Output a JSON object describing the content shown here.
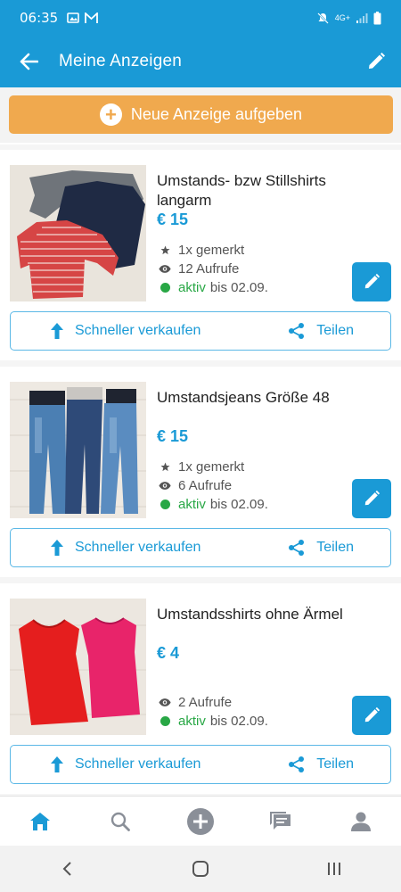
{
  "status_bar": {
    "time": "06:35",
    "network": "4G+"
  },
  "app_bar": {
    "title": "Meine Anzeigen"
  },
  "new_ad_button": {
    "label": "Neue Anzeige aufgeben"
  },
  "ads": [
    {
      "title": "Umstands- bzw Stillshirts langarm",
      "price": "€ 15",
      "saved": "1x gemerkt",
      "views": "12 Aufrufe",
      "status": "aktiv",
      "until": "bis 02.09.",
      "image": "long-sleeve-shirts"
    },
    {
      "title": "Umstandsjeans Größe 48",
      "price": "€ 15",
      "saved": "1x gemerkt",
      "views": "6 Aufrufe",
      "status": "aktiv",
      "until": "bis 02.09.",
      "image": "jeans"
    },
    {
      "title": "Umstandsshirts ohne Ärmel",
      "price": "€ 4",
      "views": "2 Aufrufe",
      "status": "aktiv",
      "until": "bis 02.09.",
      "image": "sleeveless-shirts"
    }
  ],
  "card_actions": {
    "sell_faster": "Schneller verkaufen",
    "share": "Teilen"
  },
  "colors": {
    "primary": "#1a9ad6",
    "accent": "#f0a94e",
    "active": "#28a745"
  },
  "bottom_nav": [
    "home-icon",
    "search-icon",
    "add-icon",
    "messages-icon",
    "profile-icon"
  ]
}
